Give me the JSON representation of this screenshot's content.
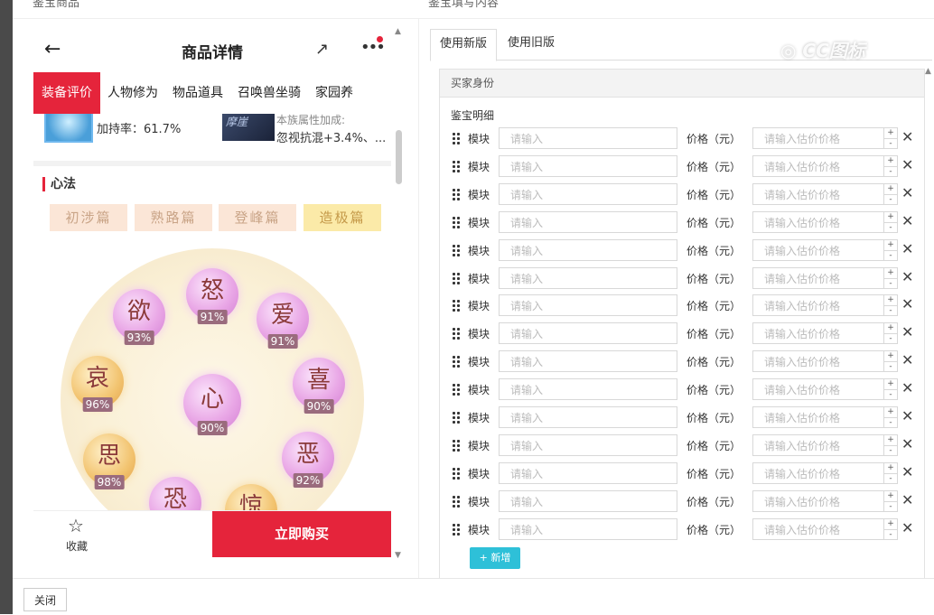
{
  "window": {
    "left_header": "鉴宝商品",
    "right_header": "鉴宝填写内容"
  },
  "phone": {
    "title": "商品详情",
    "tabs": [
      "装备评价",
      "人物修为",
      "物品道具",
      "召唤兽坐骑",
      "家园养"
    ],
    "rate_text": "加持率：61.7%",
    "thumb_text": "摩崖",
    "bonus_line1": "本族属性加成:",
    "bonus_line2": "忽视抗混+3.4%、...",
    "section_title": "心法",
    "levels": [
      "初涉篇",
      "熟路篇",
      "登峰篇",
      "造极篇"
    ],
    "orbs": [
      {
        "char": "怒",
        "pct": "91%"
      },
      {
        "char": "欲",
        "pct": "93%"
      },
      {
        "char": "爱",
        "pct": "91%"
      },
      {
        "char": "哀",
        "pct": "96%"
      },
      {
        "char": "心",
        "pct": "90%"
      },
      {
        "char": "喜",
        "pct": "90%"
      },
      {
        "char": "思",
        "pct": "98%"
      },
      {
        "char": "恶",
        "pct": "92%"
      },
      {
        "char": "恐",
        "pct": ""
      },
      {
        "char": "惊",
        "pct": ""
      }
    ],
    "favorite_label": "收藏",
    "buy_label": "立即购买"
  },
  "editor": {
    "tabs": [
      "使用新版",
      "使用旧版"
    ],
    "box_title": "买家身份",
    "detail_label": "鉴宝明细",
    "module_label": "模块",
    "input_placeholder": "请输入",
    "price_label": "价格（元）",
    "price_placeholder": "请输入估价价格",
    "row_count": 15,
    "add_label": "新增"
  },
  "footer": {
    "close_label": "关闭"
  },
  "watermark": "CC图标",
  "colors": {
    "accent_red": "#e5243b",
    "add_cyan": "#2ec0d8"
  }
}
